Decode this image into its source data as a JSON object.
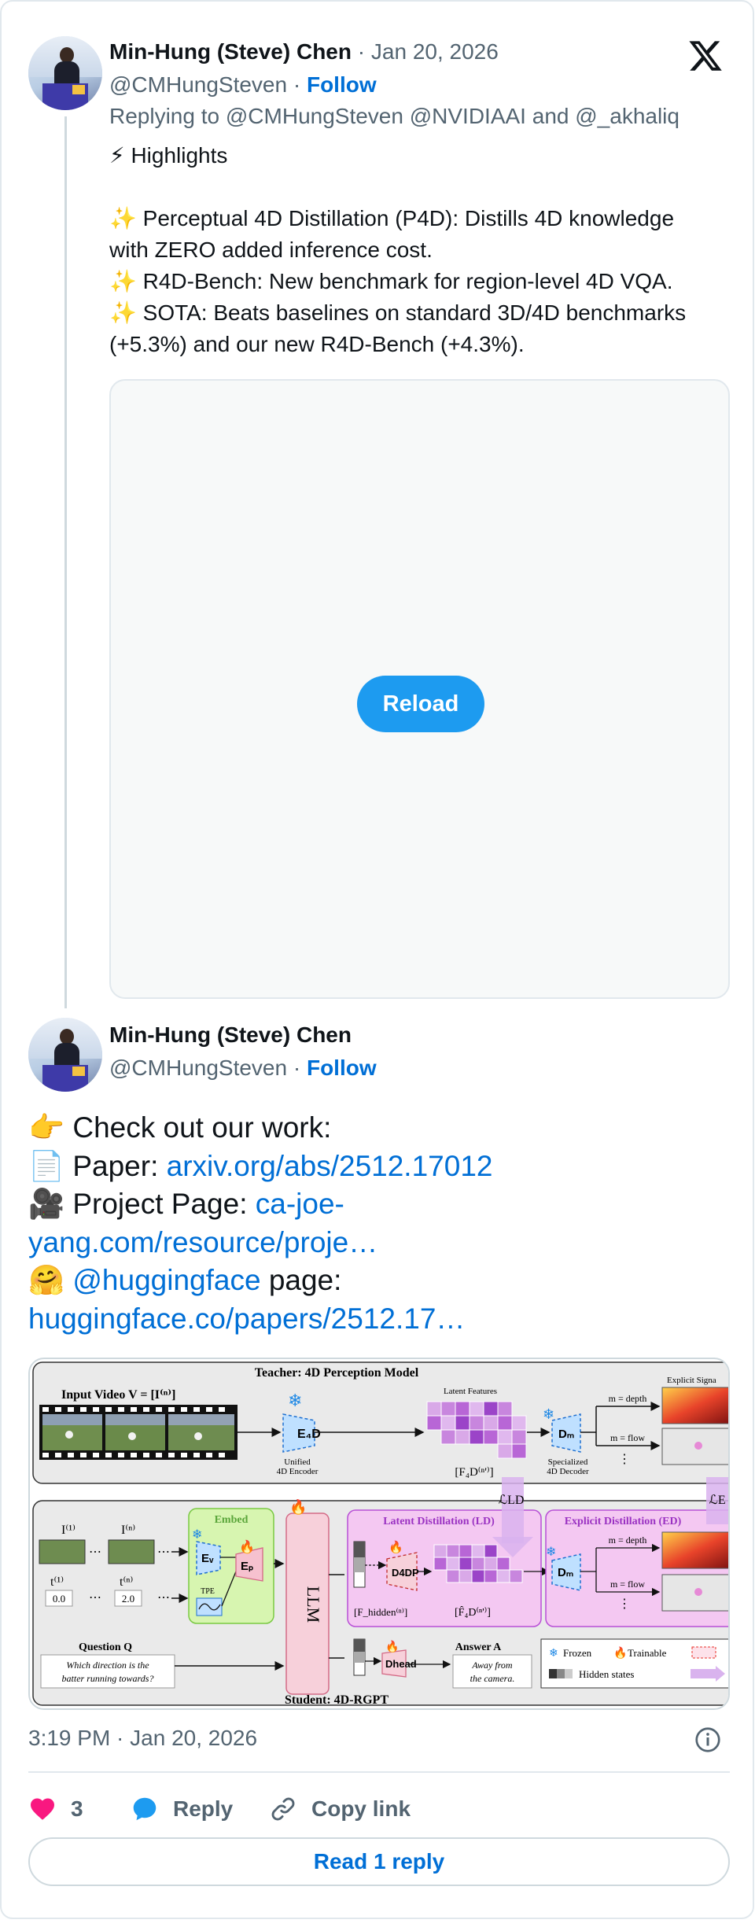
{
  "tweet1": {
    "author_name": "Min-Hung (Steve) Chen",
    "date": "Jan 20, 2026",
    "handle": "@CMHungSteven",
    "follow_label": "Follow",
    "replying_prefix": "Replying to",
    "replying_to": [
      "@CMHungSteven",
      "@NVIDIAAI",
      "@_akhaliq"
    ],
    "replying_and": "and",
    "text_lines": [
      "⚡ Highlights",
      "",
      "✨ Perceptual 4D Distillation (P4D): Distills 4D knowledge",
      "with ZERO added inference cost.",
      "✨ R4D-Bench: New benchmark for region-level 4D VQA.",
      "✨ SOTA: Beats baselines on standard 3D/4D benchmarks",
      "(+5.3%) and our new R4D-Bench (+4.3%)."
    ],
    "reload_label": "Reload"
  },
  "tweet2": {
    "author_name": "Min-Hung (Steve) Chen",
    "handle": "@CMHungSteven",
    "follow_label": "Follow",
    "line1": "👉 Check out our work:",
    "paper_prefix": "📄 Paper: ",
    "paper_link": "arxiv.org/abs/2512.17012",
    "project_prefix": "🎥 Project Page: ",
    "project_link_a": "ca-joe-",
    "project_link_b": "yang.com/resource/proje…",
    "hf_prefix": "🤗 ",
    "hf_mention": "@huggingface",
    "hf_suffix": " page:",
    "hf_link": "huggingface.co/papers/2512.17…"
  },
  "figure": {
    "teacher_title": "Teacher: 4D Perception Model",
    "input_video": "Input Video V = [I⁽ⁿ⁾]",
    "latent_features": "Latent Features",
    "e4d": "E₄D",
    "unified_encoder_1": "Unified",
    "unified_encoder_2": "4D Encoder",
    "f4d": "[F₄D⁽ⁿ'⁾]",
    "dm": "Dₘ",
    "specialized_decoder_1": "Specialized",
    "specialized_decoder_2": "4D Decoder",
    "m_depth": "m = depth",
    "m_flow": "m = flow",
    "explicit_signals": "Explicit Signa",
    "embed": "Embed",
    "ev": "Eᵥ",
    "ep": "Eₚ",
    "tpe": "TPE",
    "llm": "LLM",
    "latent_distillation": "Latent Distillation (LD)",
    "explicit_distillation": "Explicit Distillation (ED)",
    "l_ld": "ℒLD",
    "l_e": "ℒE",
    "d4dp": "D4DP",
    "f_hidden": "[F_hidden⁽ⁿ⁾]",
    "f4d_hat": "[F̂₄D⁽ⁿ'⁾]",
    "i1": "I⁽¹⁾",
    "in": "I⁽ⁿ⁾",
    "t1": "t⁽¹⁾",
    "tn": "t⁽ⁿ⁾",
    "t1_val": "0.0",
    "tn_val": "2.0",
    "question_title": "Question Q",
    "question_1": "Which direction is the",
    "question_2": "batter running towards?",
    "dhead": "Dhead",
    "answer_title": "Answer A",
    "answer_1": "Away from",
    "answer_2": "the camera.",
    "student_title": "Student: 4D-RGPT",
    "legend_frozen": "Frozen",
    "legend_trainable": "Trainable",
    "legend_hidden": "Hidden states"
  },
  "footer": {
    "timestamp": "3:19 PM · Jan 20, 2026",
    "like_count": "3",
    "reply_label": "Reply",
    "copy_link_label": "Copy link",
    "read_reply_label": "Read 1 reply"
  },
  "colors": {
    "link": "#006fd6",
    "reload": "#1d9bf0",
    "heart": "#f91880",
    "reply_bubble": "#1d9bf0",
    "muted": "#536471",
    "border": "#e1e8ed"
  }
}
